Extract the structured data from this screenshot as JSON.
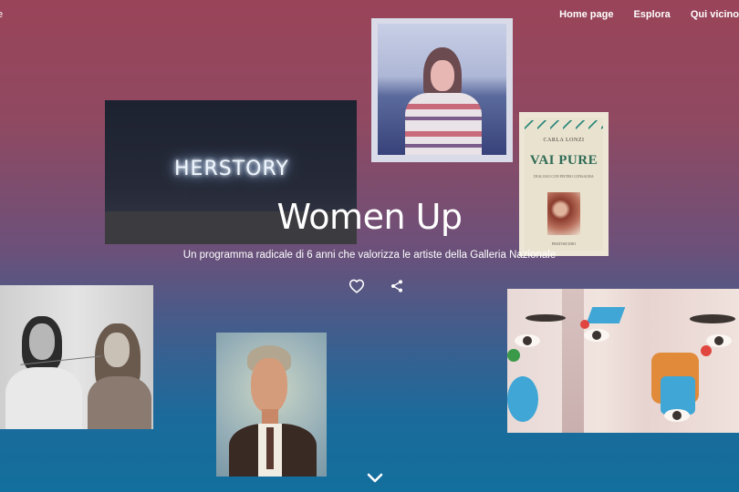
{
  "nav": {
    "edge_label": "e",
    "links": [
      "Home page",
      "Esplora",
      "Qui vicino"
    ]
  },
  "artworks": {
    "neon_text": "HERSTORY",
    "book": {
      "author": "CARLA LONZI",
      "title": "VAI PURE",
      "subtitle": "DIALOGO CON PIETRO CONSAGRA",
      "publisher": "PRATOSCURO"
    }
  },
  "hero": {
    "title": "Women Up",
    "subtitle": "Un programma radicale di 6 anni che valorizza le artiste della Galleria Nazionale"
  },
  "icons": {
    "like": "heart-icon",
    "share": "share-icon",
    "scroll": "chevron-down-icon"
  },
  "colors": {
    "background_top": "#9a4459",
    "background_bottom": "#136f9d",
    "text": "#ffffff"
  }
}
